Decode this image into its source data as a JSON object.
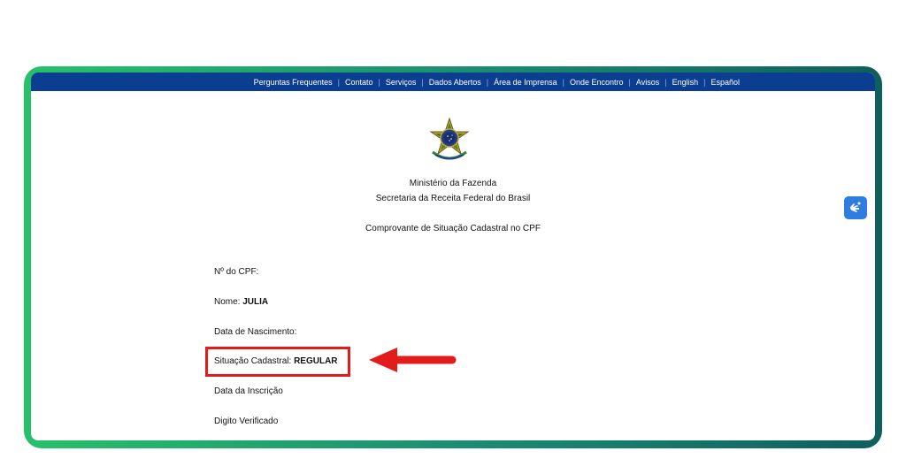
{
  "nav": {
    "items": [
      "Perguntas Frequentes",
      "Contato",
      "Serviços",
      "Dados Abertos",
      "Área de Imprensa",
      "Onde Encontro",
      "Avisos",
      "English",
      "Español"
    ]
  },
  "header": {
    "ministry": "Ministério da Fazenda",
    "secretariat": "Secretaria da Receita Federal do Brasil",
    "document_title": "Comprovante de Situação Cadastral no CPF"
  },
  "fields": {
    "cpf_label": "Nº do CPF:",
    "name_label": "Nome:",
    "name_value": "JULIA",
    "birth_label": "Data de Nascimento:",
    "status_label": "Situação Cadastral:",
    "status_value": "REGULAR",
    "inscription_label": "Data da Inscrição",
    "check_digit_label": "Digito Verificado"
  },
  "colors": {
    "nav_bg": "#0b3d91",
    "highlight": "#e21b1b",
    "frame_start": "#27c16a",
    "frame_end": "#0f5f5c",
    "accessibility_button": "#2f7de1"
  },
  "icons": {
    "seal": "brazil-coat-of-arms-icon",
    "accessibility": "sign-language-icon",
    "pointer": "arrow-left-icon"
  }
}
